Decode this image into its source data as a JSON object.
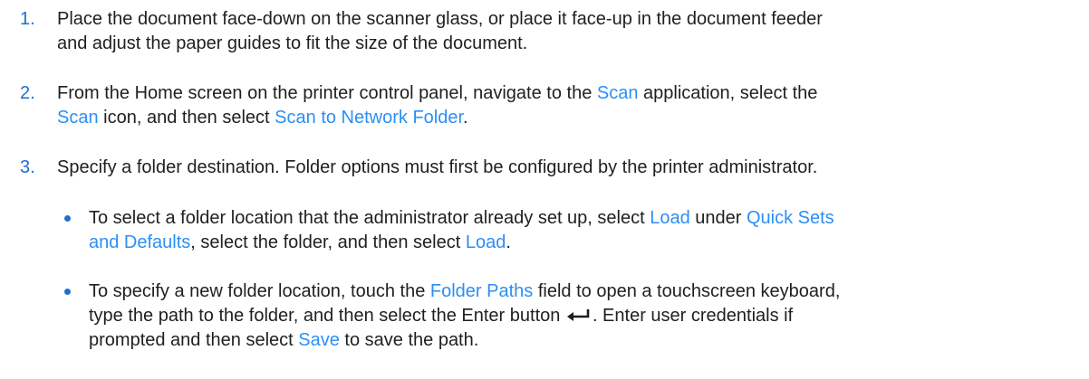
{
  "steps": [
    {
      "number": "1.",
      "line1": "Place the document face-down on the scanner glass, or place it face-up in the document feeder",
      "line2": "and adjust the paper guides to fit the size of the document."
    },
    {
      "number": "2.",
      "line1_a": "From the Home screen on the printer control panel, navigate to the ",
      "line1_link": "Scan",
      "line1_b": " application, select the",
      "line2_link1": "Scan",
      "line2_a": " icon, and then select ",
      "line2_link2": "Scan to Network Folder",
      "line2_end": "."
    },
    {
      "number": "3.",
      "line1": "Specify a folder destination. Folder options must first be configured by the printer administrator."
    }
  ],
  "bullets": [
    {
      "line1_a": "To select a folder location that the administrator already set up, select ",
      "line1_link1": "Load",
      "line1_b": " under ",
      "line1_link2": "Quick Sets",
      "line2_link": "and Defaults",
      "line2_a": ", select the folder, and then select ",
      "line2_link2": "Load",
      "line2_end": "."
    },
    {
      "line1_a": "To specify a new folder location, touch the ",
      "line1_link": "Folder Paths",
      "line1_b": " field to open a touchscreen keyboard,",
      "line2_a": "type the path to the folder, and then select the Enter button ",
      "line2_b": ". Enter user credentials if",
      "line3_a": "prompted and then select ",
      "line3_link": "Save",
      "line3_b": " to save the path."
    }
  ],
  "icons": {
    "enter": "enter-key-icon"
  },
  "colors": {
    "text": "#1f1f1f",
    "link": "#2c8ff5",
    "number": "#1f6fd0"
  }
}
